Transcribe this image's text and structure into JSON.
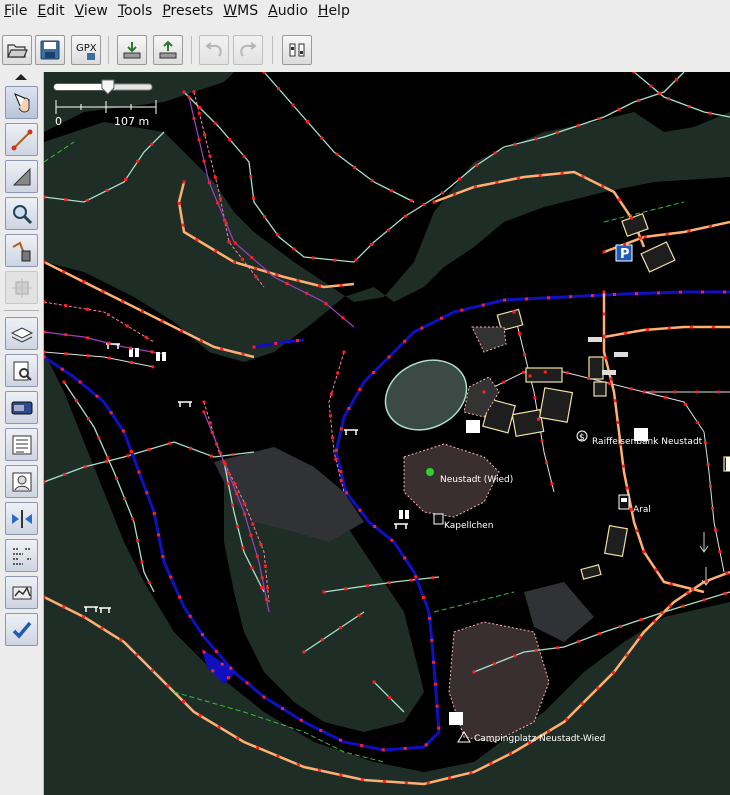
{
  "menu": [
    {
      "label": "File",
      "mnemonic": "F",
      "rest": "ile"
    },
    {
      "label": "Edit",
      "mnemonic": "E",
      "rest": "dit"
    },
    {
      "label": "View",
      "mnemonic": "V",
      "rest": "iew"
    },
    {
      "label": "Tools",
      "mnemonic": "T",
      "rest": "ools"
    },
    {
      "label": "Presets",
      "mnemonic": "P",
      "rest": "resets"
    },
    {
      "label": "WMS",
      "mnemonic": "W",
      "rest": "MS"
    },
    {
      "label": "Audio",
      "mnemonic": "A",
      "rest": "udio"
    },
    {
      "label": "Help",
      "mnemonic": "H",
      "rest": "elp"
    }
  ],
  "toolbar": {
    "gpx_label": "GPX",
    "icons": [
      "open-file-icon",
      "save-icon",
      "gpx-export-icon",
      "download-icon",
      "upload-icon",
      "undo-icon",
      "redo-icon",
      "preferences-icon"
    ]
  },
  "sidebar": {
    "icons": [
      "select-icon",
      "draw-icon",
      "area-icon",
      "zoom-icon",
      "delete-icon",
      "extrude-icon",
      "layers-icon",
      "properties-icon",
      "toggle-icon",
      "history-icon",
      "conflict-icon",
      "merge-icon",
      "filter-icon",
      "map-paint-icon",
      "validator-icon"
    ]
  },
  "scale": {
    "zero_label": "0",
    "distance_label": "107 m",
    "zoom_level": 0.55
  },
  "map": {
    "labels": {
      "raiffeisenbank": "Raiffeisenbank Neustadt",
      "neustadt": "Neustadt (Wied)",
      "aral": "Aral",
      "kapellchen": "Kapellchen",
      "campingplatz": "Campingplatz Neustadt-Wied"
    },
    "parking_label": "P",
    "colors": {
      "background": "#000000",
      "landuse": "#1f2d27",
      "river_edge": "#a8e0c8",
      "waterway": "#1010c0",
      "road": "#ffb070",
      "node": "#ff2020",
      "selected_route": "#a040c0"
    }
  }
}
